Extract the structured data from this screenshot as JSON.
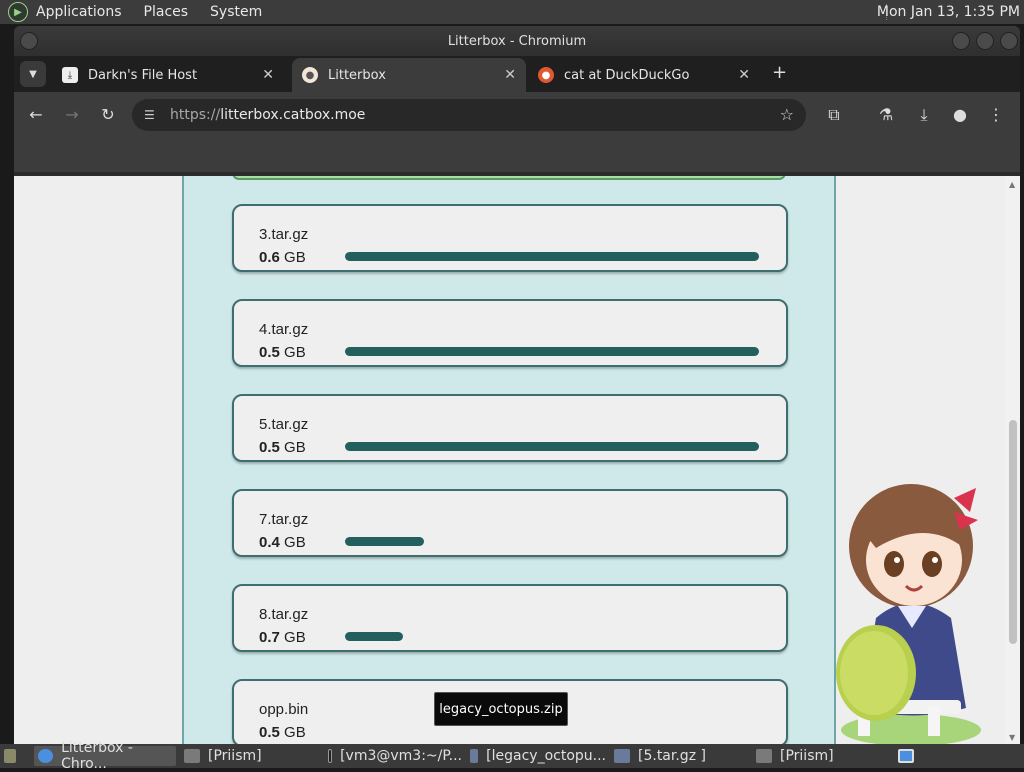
{
  "system_panel": {
    "menus": [
      "Applications",
      "Places",
      "System"
    ],
    "clock": "Mon Jan 13,  1:35 PM"
  },
  "window": {
    "title": "Litterbox - Chromium"
  },
  "tabs": [
    {
      "label": "Darkn's File Host",
      "icon": "download-icon"
    },
    {
      "label": "Litterbox",
      "icon": "cat-icon"
    },
    {
      "label": "cat at DuckDuckGo",
      "icon": "duckduckgo-icon"
    }
  ],
  "omnibox": {
    "scheme": "https://",
    "host": "litterbox.catbox.moe"
  },
  "files": [
    {
      "name": "3.tar.gz",
      "size": "0.6",
      "unit": "GB",
      "progress": 1.0
    },
    {
      "name": "4.tar.gz",
      "size": "0.5",
      "unit": "GB",
      "progress": 1.0
    },
    {
      "name": "5.tar.gz",
      "size": "0.5",
      "unit": "GB",
      "progress": 1.0
    },
    {
      "name": "7.tar.gz",
      "size": "0.4",
      "unit": "GB",
      "progress": 0.19
    },
    {
      "name": "8.tar.gz",
      "size": "0.7",
      "unit": "GB",
      "progress": 0.14
    },
    {
      "name": "opp.bin",
      "size": "0.5",
      "unit": "GB",
      "progress": 0.0
    }
  ],
  "tooltip": "legacy_octopus.zip",
  "taskbar": [
    {
      "label": "Litterbox - Chro...",
      "icon": "chromium-icon"
    },
    {
      "label": "[Priism]",
      "icon": "folder-icon"
    },
    {
      "label": "[vm3@vm3:~/P...",
      "icon": "terminal-icon"
    },
    {
      "label": "[legacy_octopu...",
      "icon": "drive-icon"
    },
    {
      "label": "[5.tar.gz ]",
      "icon": "drive-icon"
    },
    {
      "label": "[Priism]",
      "icon": "folder-icon"
    }
  ],
  "colors": {
    "progress": "#225f5d",
    "column_bg": "#cfe9ea",
    "card_border": "#3e6e70"
  }
}
